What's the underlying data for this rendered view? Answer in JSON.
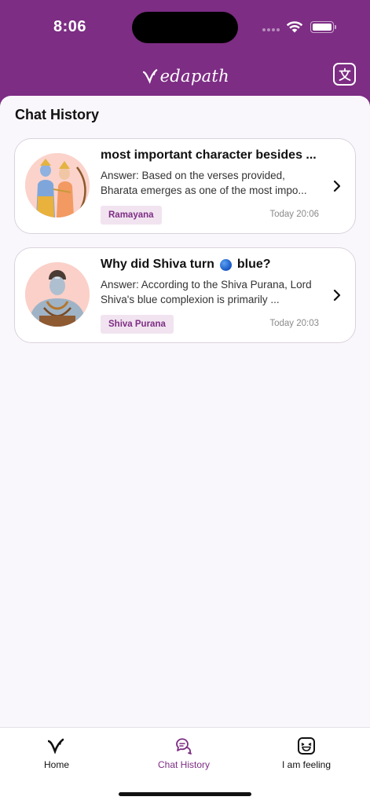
{
  "status_bar": {
    "time": "8:06"
  },
  "header": {
    "app_name": "edapath",
    "translate_icon": "translate-icon"
  },
  "page": {
    "title": "Chat History"
  },
  "chats": [
    {
      "title": "most important character besides ...",
      "answer": "Answer: Based on the verses provided, Bharata emerges as one of the most impo...",
      "tag": "Ramayana",
      "time": "Today 20:06",
      "avatar_icon": "rama-lakshmana-avatar"
    },
    {
      "title_before": "Why did Shiva turn",
      "title_after": "blue?",
      "emoji": "blue-circle-emoji",
      "answer": "Answer: According to the Shiva Purana, Lord Shiva's blue complexion is primarily ...",
      "tag": "Shiva Purana",
      "time": "Today 20:03",
      "avatar_icon": "shiva-avatar"
    }
  ],
  "bottom_nav": {
    "items": [
      {
        "label": "Home",
        "icon": "vedapath-logo-icon",
        "active": false
      },
      {
        "label": "Chat History",
        "icon": "chat-bubbles-icon",
        "active": true
      },
      {
        "label": "I am feeling",
        "icon": "laughing-face-icon",
        "active": false
      }
    ]
  },
  "colors": {
    "brand": "#7d2d84",
    "tag_bg": "#f1e4f0",
    "background": "#faf7fc"
  }
}
